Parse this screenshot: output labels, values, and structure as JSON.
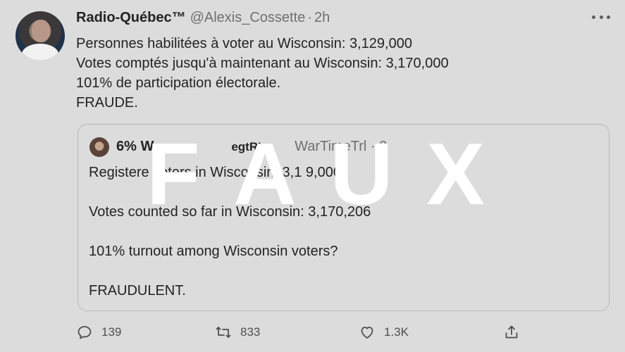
{
  "tweet": {
    "author_name": "Radio-Québec™",
    "handle": "@Alexis_Cossette",
    "separator": "·",
    "time": "2h",
    "lines": [
      "Personnes habilitées à voter au Wisconsin: 3,129,000",
      "Votes comptés jusqu'à maintenant au Wisconsin: 3,170,000",
      "101% de participation électorale.",
      "FRAUDE."
    ]
  },
  "quoted": {
    "author_name": "6% W",
    "name_tail": "egtR'",
    "handle": "WarTimeTrl · 2",
    "lines": [
      "Registere   voters in Wisconsin: 3,1  9,000",
      "",
      "Votes counted so far in Wisconsin: 3,170,206",
      "",
      "101% turnout among Wisconsin voters?",
      "",
      "FRAUDULENT."
    ]
  },
  "actions": {
    "replies": "139",
    "retweets": "833",
    "likes": "1.3K"
  },
  "overlay": {
    "letters": [
      "F",
      "A",
      "U",
      "X"
    ]
  },
  "icons": {
    "more": "more-icon",
    "reply": "reply-icon",
    "retweet": "retweet-icon",
    "like": "heart-icon",
    "share": "share-icon"
  },
  "colors": {
    "background": "#dcdcdc",
    "overlay_text": "#ffffff"
  }
}
